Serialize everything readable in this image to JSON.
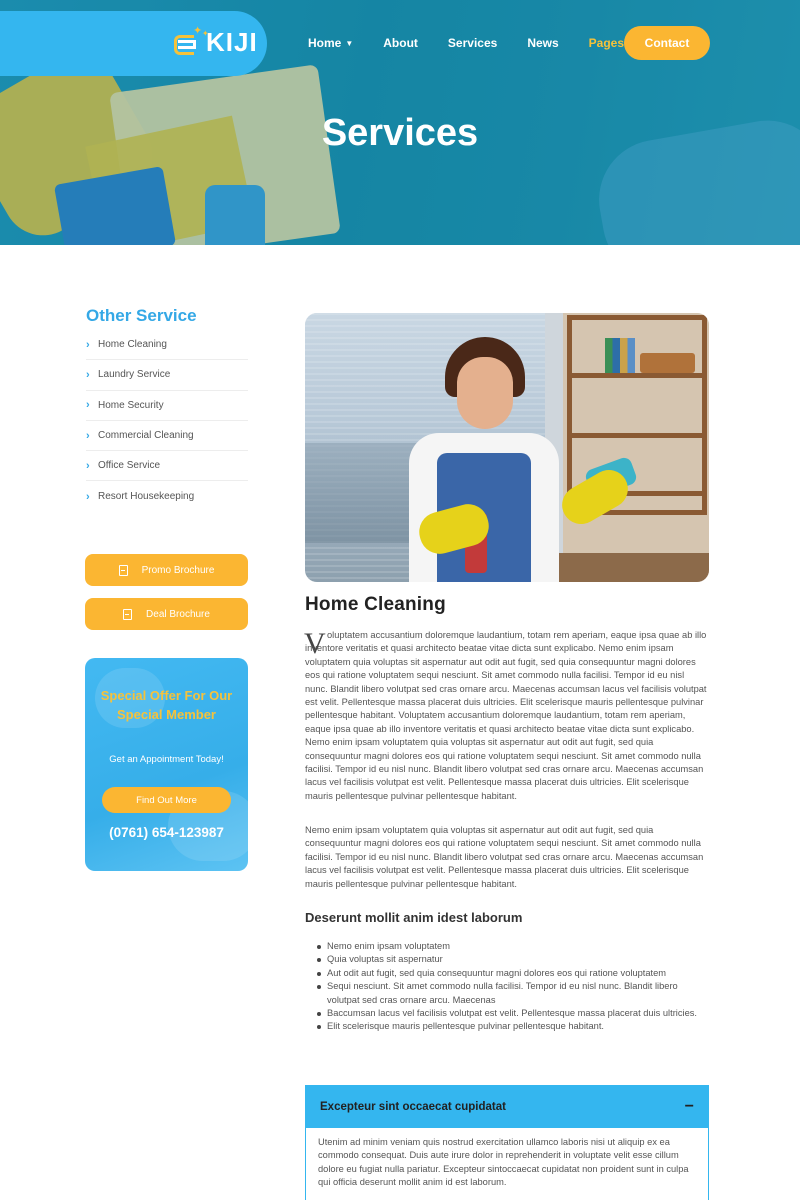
{
  "header": {
    "logo_text": "KIJI",
    "nav": [
      "Home",
      "About",
      "Services",
      "News",
      "Pages"
    ],
    "contact_label": "Contact",
    "page_title": "Services",
    "accent_color": "#34b6ef",
    "highlight_color": "#fbb632"
  },
  "sidebar": {
    "heading": "Other Service",
    "items": [
      {
        "label": "Home Cleaning"
      },
      {
        "label": "Laundry Service"
      },
      {
        "label": "Home Security"
      },
      {
        "label": "Commercial Cleaning"
      },
      {
        "label": "Office Service"
      },
      {
        "label": "Resort Housekeeping"
      }
    ],
    "brochures": [
      {
        "label": "Promo Brochure"
      },
      {
        "label": "Deal Brochure"
      }
    ],
    "offer": {
      "title": "Special Offer For Our Special Member",
      "subtitle": "Get an Appointment Today!",
      "button_label": "Find Out More",
      "phone": "(0761) 654-123987"
    }
  },
  "main": {
    "heading": "Home Cleaning",
    "dropcap": "V",
    "paragraph1": "oluptatem accusantium doloremque laudantium, totam rem aperiam, eaque ipsa quae ab illo inventore veritatis et quasi architecto beatae vitae dicta sunt explicabo. Nemo enim ipsam voluptatem quia voluptas sit aspernatur aut odit aut fugit, sed quia consequuntur magni dolores eos qui ratione voluptatem sequi nesciunt. Sit amet commodo nulla facilisi. Tempor id eu nisl nunc. Blandit libero volutpat sed cras ornare arcu. Maecenas accumsan lacus vel facilisis volutpat est velit. Pellentesque massa placerat duis ultricies. Elit scelerisque mauris pellentesque pulvinar pellentesque habitant. Voluptatem accusantium doloremque laudantium, totam rem aperiam, eaque ipsa quae ab illo inventore veritatis et quasi architecto beatae vitae dicta sunt explicabo. Nemo enim ipsam voluptatem quia voluptas sit aspernatur aut odit aut fugit, sed quia consequuntur magni dolores eos qui ratione voluptatem sequi nesciunt. Sit amet commodo nulla facilisi. Tempor id eu nisl nunc. Blandit libero volutpat sed cras ornare arcu. Maecenas accumsan lacus vel facilisis volutpat est velit. Pellentesque massa placerat duis ultricies. Elit scelerisque mauris pellentesque pulvinar pellentesque habitant.",
    "paragraph2": "Nemo enim ipsam voluptatem quia voluptas sit aspernatur aut odit aut fugit, sed quia consequuntur magni dolores eos qui ratione voluptatem sequi nesciunt. Sit amet commodo nulla facilisi. Tempor id eu nisl nunc. Blandit libero volutpat sed cras ornare arcu. Maecenas accumsan lacus vel facilisis volutpat est velit. Pellentesque massa placerat duis ultricies. Elit scelerisque mauris pellentesque pulvinar pellentesque habitant.",
    "subheading": "Deserunt mollit anim idest laborum",
    "bullets": [
      "Nemo enim ipsam voluptatem",
      "Quia voluptas sit aspernatur",
      "Aut odit aut fugit, sed quia consequuntur magni dolores eos qui ratione voluptatem",
      "Sequi nesciunt. Sit amet commodo nulla facilisi. Tempor id eu nisl nunc. Blandit libero volutpat sed cras ornare arcu. Maecenas",
      "Baccumsan lacus vel facilisis volutpat est velit. Pellentesque massa placerat duis ultricies.",
      "Elit scelerisque mauris pellentesque pulvinar pellentesque habitant."
    ],
    "accordion": {
      "title": "Excepteur sint occaecat cupidatat",
      "toggle": "−",
      "body": "Utenim ad minim veniam quis nostrud exercitation ullamco laboris nisi ut aliquip ex ea commodo consequat. Duis aute irure dolor in reprehenderit in voluptate velit esse cillum dolore eu fugiat nulla pariatur. Excepteur sintoccaecat cupidatat non proident sunt in culpa qui officia deserunt mollit anim id est laborum."
    }
  }
}
